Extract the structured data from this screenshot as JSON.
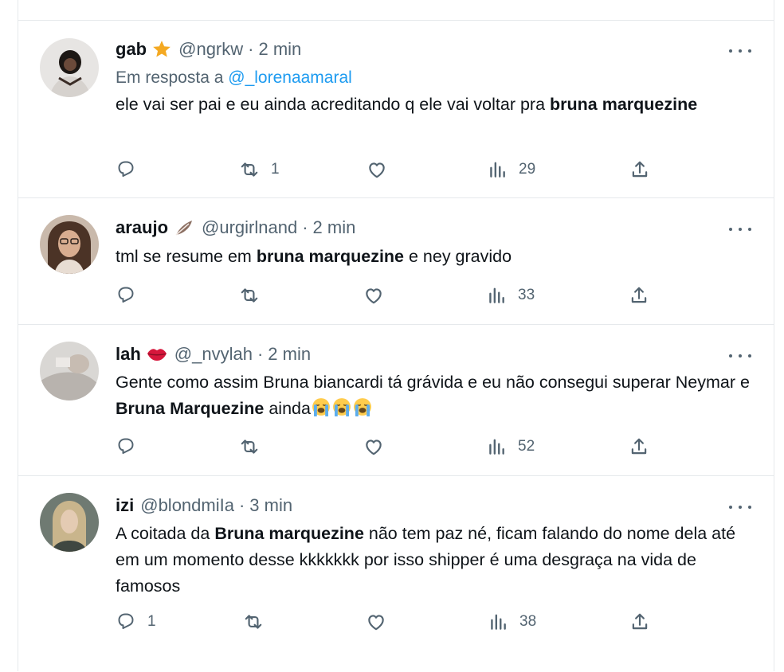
{
  "colors": {
    "text": "#0f1419",
    "secondary": "#536471",
    "link": "#1d9bf0",
    "border": "#e6e9ec"
  },
  "tweets": [
    {
      "name": "gab",
      "badge_icon": "star-icon",
      "handle": "@ngrkw",
      "dot": "·",
      "time": "2 min",
      "reply_prefix": "Em resposta a",
      "reply_mention": "@_lorenaamaral",
      "text_plain_1": "ele vai ser pai e eu ainda acreditando q ele vai voltar pra ",
      "text_bold_1": "bruna marquezine",
      "replies": "",
      "retweets": "1",
      "likes": "",
      "views": "29"
    },
    {
      "name": "araujo",
      "badge_icon": "feather-icon",
      "handle": "@urgirlnand",
      "dot": "·",
      "time": "2 min",
      "text_plain_1": "tml se resume em ",
      "text_bold_1": "bruna marquezine",
      "text_plain_2": " e ney gravido",
      "replies": "",
      "retweets": "",
      "likes": "",
      "views": "33"
    },
    {
      "name": "lah",
      "badge_icon": "kiss-lips-icon",
      "handle": "@_nvylah",
      "dot": "·",
      "time": "2 min",
      "text_plain_1": "Gente como assim Bruna biancardi tá grávida e eu não consegui superar Neymar e ",
      "text_bold_1": "Bruna Marquezine",
      "text_plain_2": " ainda",
      "emoji_icon": "loudly-crying-face-icon",
      "replies": "",
      "retweets": "",
      "likes": "",
      "views": "52"
    },
    {
      "name": "izi",
      "handle": "@blondmiIa",
      "dot": "·",
      "time": "3 min",
      "text_plain_1": "A coitada da ",
      "text_bold_1": "Bruna marquezine",
      "text_plain_2": " não tem paz né, ficam falando do nome dela até em um momento desse kkkkkkk por isso shipper é uma desgraça na vida de famosos",
      "replies": "1",
      "retweets": "",
      "likes": "",
      "views": "38"
    }
  ]
}
